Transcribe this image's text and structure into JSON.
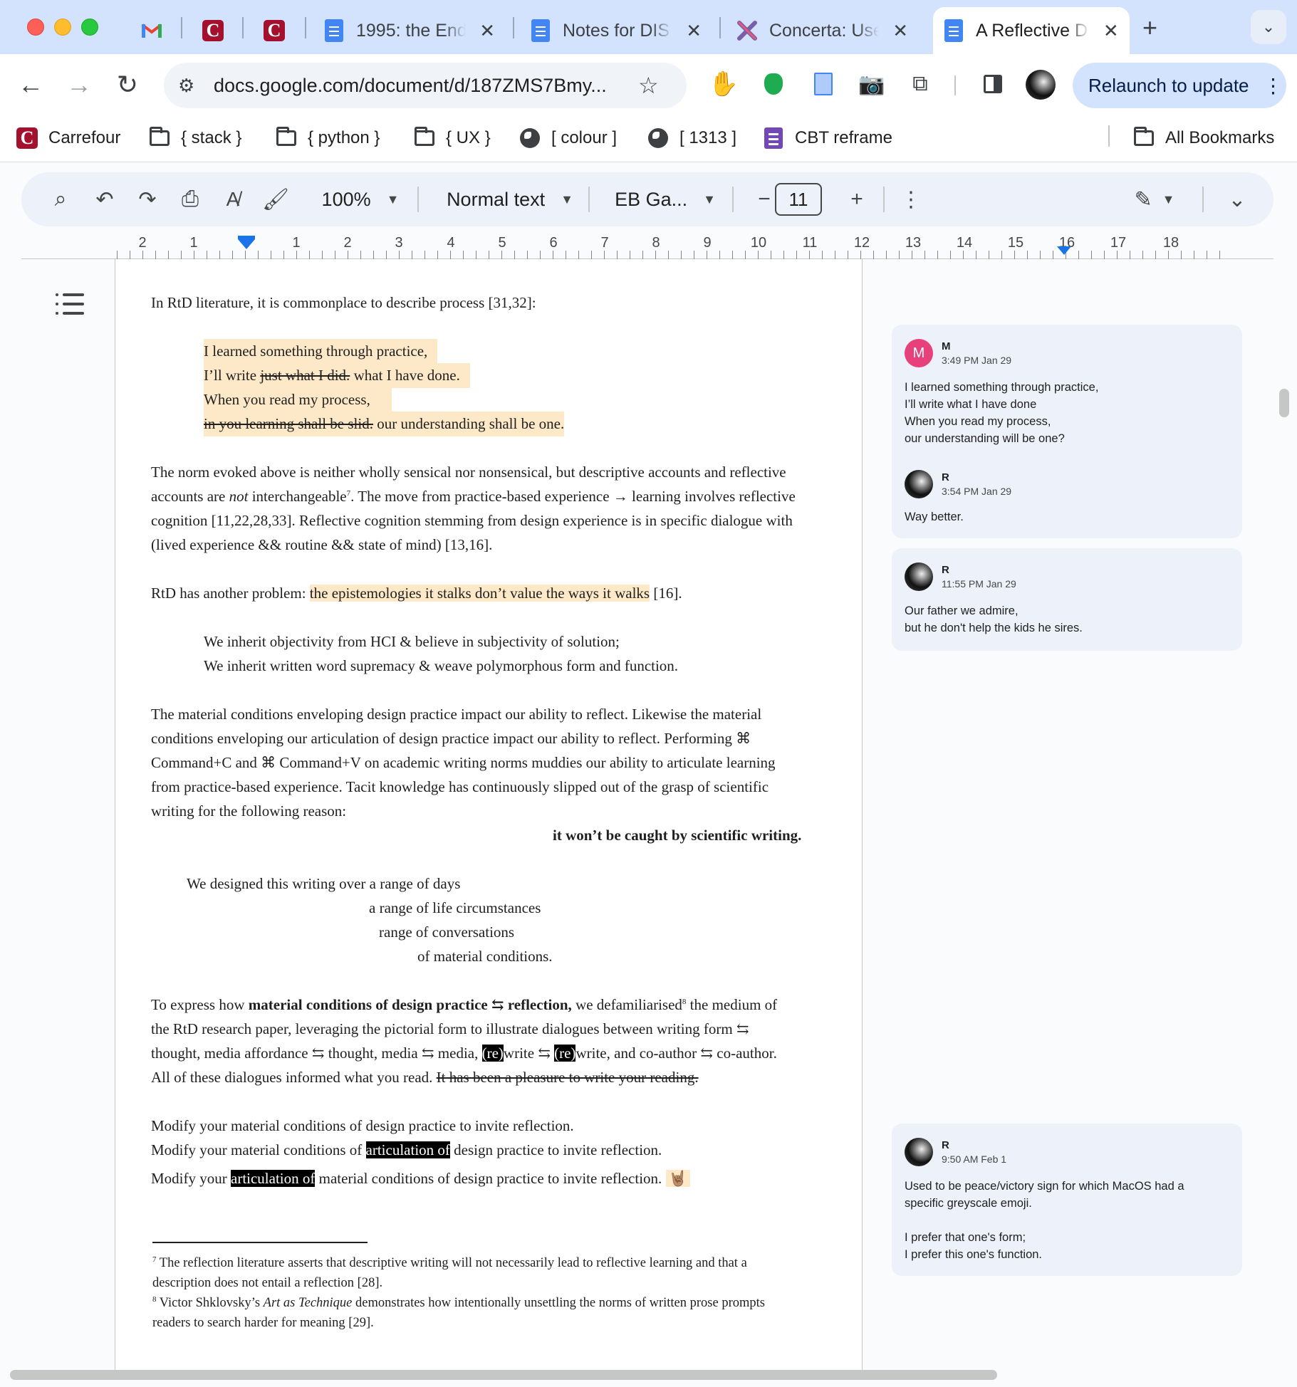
{
  "browser": {
    "tabs": [
      {
        "label": "",
        "icon": "gmail-icon"
      },
      {
        "label": "",
        "icon": "carrefour-icon"
      },
      {
        "label": "",
        "icon": "carrefour-icon"
      },
      {
        "label": "1995: the End",
        "icon": "docs-icon"
      },
      {
        "label": "Notes for DIS",
        "icon": "docs-icon"
      },
      {
        "label": "Concerta: Use",
        "icon": "concerta-icon"
      },
      {
        "label": "A Reflective D",
        "icon": "docs-icon",
        "active": true
      }
    ],
    "url": "docs.google.com/document/d/187ZMS7Bmy...",
    "relaunch_label": "Relaunch to update",
    "bookmarks": [
      {
        "label": "Carrefour",
        "icon": "carrefour-icon"
      },
      {
        "label": "{ stack }",
        "icon": "folder-icon"
      },
      {
        "label": "{ python }",
        "icon": "folder-icon"
      },
      {
        "label": "{ UX }",
        "icon": "folder-icon"
      },
      {
        "label": "[ colour ]",
        "icon": "globe-icon"
      },
      {
        "label": "[ 1313 ]",
        "icon": "globe-icon"
      },
      {
        "label": "CBT reframe",
        "icon": "forms-icon"
      },
      {
        "label": "All Bookmarks",
        "icon": "folder-icon"
      }
    ]
  },
  "docs_toolbar": {
    "zoom": "100%",
    "style": "Normal text",
    "font": "EB Ga...",
    "font_size": "11"
  },
  "ruler": {
    "numbers": [
      "2",
      "1",
      "1",
      "2",
      "3",
      "4",
      "5",
      "6",
      "7",
      "8",
      "9",
      "10",
      "11",
      "12",
      "13",
      "14",
      "15",
      "16",
      "17",
      "18"
    ]
  },
  "document": {
    "p1": "In RtD literature, it is commonplace to describe process [31,32]:",
    "poem1": {
      "l1": "I learned something through practice,",
      "l2a": "I’ll write ",
      "l2b": "just what I did.",
      "l2c": " what I have done.",
      "l3": "When you read my process,",
      "l4a": "in you learning shall be slid.",
      "l4b": " our understanding shall be one."
    },
    "p2": {
      "a": "The norm evoked  above is neither wholly sensical nor nonsensical, but descriptive accounts and reflective",
      "b1": "accounts are ",
      "b2": "not",
      "b3": " interchangeable",
      "b4": "7",
      "b5": ". The move from practice-based experience → learning involves reflective",
      "c": "cognition [11,22,28,33]. Reflective cognition stemming from design experience is in specific dialogue with",
      "d": "(lived experience && routine && state of mind) [13,16]."
    },
    "p3": {
      "a": "RtD has another problem: ",
      "b": "the epistemologies it stalks don’t value the ways it walks",
      "c": " [16]."
    },
    "quote": {
      "l1": "We inherit objectivity from HCI & believe in subjectivity of solution;",
      "l2": "We inherit written word supremacy & weave polymorphous form and function."
    },
    "p4": {
      "a": "The material conditions enveloping design practice impact our ability to reflect. Likewise the material",
      "b": "conditions enveloping our articulation of design practice impact our ability to reflect. Performing ⌘",
      "c": "Command+C and ⌘ Command+V on academic writing norms muddies our ability to articulate learning",
      "d": "from practice-based experience. Tacit knowledge has continuously slipped out of the grasp of scientific",
      "e": "writing for the following reason:",
      "bold": "it won’t be caught by scientific writing."
    },
    "poem2": {
      "l1": "We designed this writing over a range of days",
      "l2": "a range of life circumstances",
      "l3": "range of conversations",
      "l4": "of material conditions."
    },
    "p5": {
      "a1": "To express how ",
      "a2": "material conditions of design practice ⇆ reflection,",
      "a3": " we defamiliarised",
      "a4": "8",
      "a5": " the medium of",
      "b": "the RtD research paper, leveraging the pictorial form to illustrate dialogues between writing form ⇆",
      "c1": "thought, media affordance ⇆ thought, media ⇆ media, ",
      "c2": "(re)",
      "c3": "write ⇆ ",
      "c4": "(re)",
      "c5": "write, and co-author ⇆ co-author.",
      "d1": "All of these dialogues informed what you read.  ",
      "d2": "It has been a pleasure to write your reading."
    },
    "p6": {
      "l1": "Modify your material conditions of design practice to invite reflection.",
      "l2a": "Modify your material conditions of ",
      "l2b": "articulation of",
      "l2c": " design practice to invite reflection.",
      "l3a": "Modify your ",
      "l3b": "articulation of",
      "l3c": " material conditions of design practice to invite reflection. ",
      "l3d": "🤘🏽"
    },
    "footnotes": {
      "f7a": "7",
      "f7b": " The reflection literature asserts that descriptive writing will not necessarily lead to reflective learning and that a",
      "f7c": "description does not entail a reflection [28].",
      "f8a": "8",
      "f8b": " Victor Shklovsky’s ",
      "f8c": "Art as Technique",
      "f8d": " demonstrates how intentionally unsettling the norms of written prose prompts",
      "f8e": "readers to search harder for meaning [29]."
    }
  },
  "comments": [
    {
      "entries": [
        {
          "initial": "M",
          "name": "M",
          "time": "3:49 PM Jan 29",
          "lines": [
            "I learned something through practice,",
            "I’ll write what I have done",
            "When you read my process,",
            "our understanding will be one?"
          ]
        },
        {
          "name": "R",
          "time": "3:54 PM Jan 29",
          "lines": [
            "Way better."
          ]
        }
      ]
    },
    {
      "entries": [
        {
          "name": "R",
          "time": "11:55 PM Jan 29",
          "lines": [
            "Our father we admire,",
            "but he don't help the kids he sires."
          ]
        }
      ]
    },
    {
      "entries": [
        {
          "name": "R",
          "time": "9:50 AM Feb 1",
          "lines": [
            "Used to be peace/victory sign for which MacOS had a",
            "specific greyscale emoji.",
            "",
            "I prefer that one's form;",
            "I prefer this one's function."
          ]
        }
      ]
    }
  ]
}
